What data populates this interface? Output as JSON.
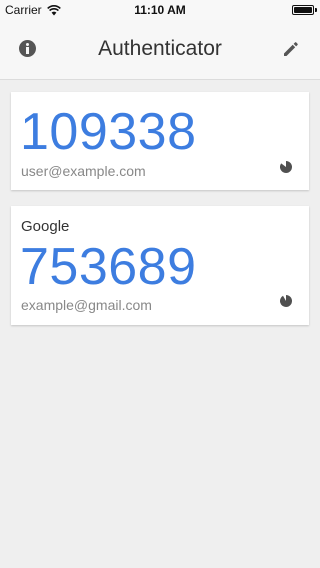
{
  "status_bar": {
    "carrier": "Carrier",
    "time": "11:10 AM"
  },
  "nav": {
    "title": "Authenticator",
    "left_icon": "info-icon",
    "right_icon": "pencil-icon"
  },
  "accounts": [
    {
      "issuer": "",
      "code": "109338",
      "account": "user@example.com"
    },
    {
      "issuer": "Google",
      "code": "753689",
      "account": "example@gmail.com"
    }
  ],
  "colors": {
    "code": "#3d7de0",
    "background": "#efefef",
    "card": "#ffffff"
  }
}
